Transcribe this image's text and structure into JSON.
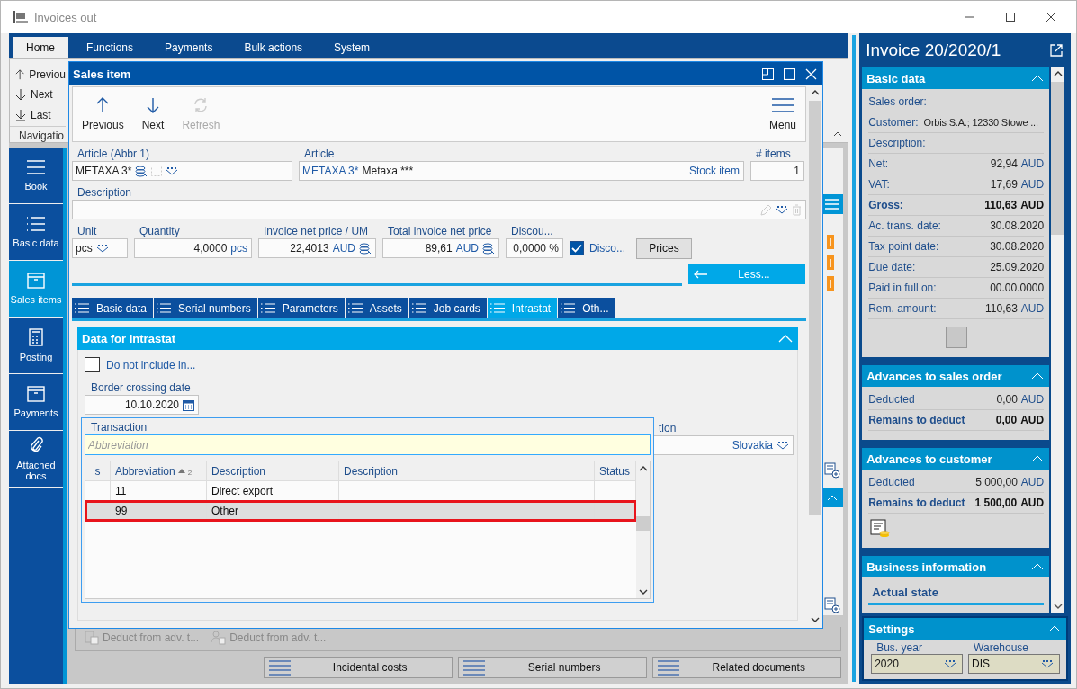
{
  "window": {
    "title": "Invoices out"
  },
  "ribbon": {
    "tabs": [
      {
        "label": "Home",
        "selected": true
      },
      {
        "label": "Functions",
        "selected": false
      },
      {
        "label": "Payments",
        "selected": false
      },
      {
        "label": "Bulk actions",
        "selected": false
      },
      {
        "label": "System",
        "selected": false
      }
    ],
    "items": [
      {
        "label": "Previou",
        "kind": "up"
      },
      {
        "label": "Next",
        "kind": "down"
      },
      {
        "label": "Last",
        "kind": "last"
      }
    ],
    "group": "Navigatio"
  },
  "nav": [
    {
      "label": "Book",
      "kind": "lines",
      "selected": false
    },
    {
      "label": "Basic data",
      "kind": "list",
      "selected": false
    },
    {
      "label": "Sales items",
      "kind": "box",
      "selected": true
    },
    {
      "label": "Posting",
      "kind": "calc",
      "selected": false
    },
    {
      "label": "Payments",
      "kind": "box",
      "selected": false
    },
    {
      "label": "Attached docs",
      "kind": "clip",
      "selected": false
    }
  ],
  "deduct_buttons": [
    {
      "label": "Deduct from adv. t...",
      "kind": "doc",
      "disabled": true
    },
    {
      "label": "Deduct from adv. t...",
      "kind": "person",
      "disabled": true
    }
  ],
  "bottom_buttons": [
    "Incidental costs",
    "Serial numbers",
    "Related documents"
  ],
  "dialog": {
    "title": "Sales item",
    "toolbar": [
      {
        "label": "Previous",
        "kind": "up",
        "disabled": false
      },
      {
        "label": "Next",
        "kind": "down",
        "disabled": false
      },
      {
        "label": "Refresh",
        "kind": "refresh",
        "disabled": true
      }
    ],
    "menu": "Menu",
    "article_abbr": {
      "label": "Article (Abbr 1)",
      "value": "METAXA 3*"
    },
    "article": {
      "label": "Article",
      "code": "METAXA 3*",
      "name": "Metaxa ***",
      "type": "Stock item"
    },
    "items_count": {
      "label": "# items",
      "value": "1"
    },
    "description": {
      "label": "Description"
    },
    "unit": {
      "label": "Unit",
      "value": "pcs"
    },
    "quantity": {
      "label": "Quantity",
      "value": "4,0000",
      "unit": "pcs"
    },
    "unit_price": {
      "label": "Invoice net price / UM",
      "value": "22,4013",
      "unit": "AUD"
    },
    "total_price": {
      "label": "Total invoice net price",
      "value": "89,61",
      "unit": "AUD"
    },
    "discount": {
      "label": "Discou...",
      "value": "0,0000 %"
    },
    "discount_check": {
      "label": "Disco...",
      "checked": true
    },
    "prices_button": "Prices",
    "less_button": "Less...",
    "tabs": [
      {
        "label": "Basic data",
        "selected": false
      },
      {
        "label": "Serial numbers",
        "selected": false
      },
      {
        "label": "Parameters",
        "selected": false
      },
      {
        "label": "Assets",
        "selected": false
      },
      {
        "label": "Job cards",
        "selected": false
      },
      {
        "label": "Intrastat",
        "selected": true
      },
      {
        "label": "Oth...",
        "selected": false
      }
    ],
    "intrastat": {
      "title": "Data for Intrastat",
      "exclude": {
        "label": "Do not include in...",
        "checked": false
      },
      "border_date": {
        "label": "Border crossing date",
        "value": "10.10.2020"
      },
      "country": {
        "label": "tion",
        "value": "Slovakia"
      }
    },
    "lookup": {
      "label": "Transaction",
      "placeholder": "Abbreviation",
      "columns": [
        {
          "label": "s"
        },
        {
          "label": "Abbreviation",
          "sort": "2"
        },
        {
          "label": "Description"
        },
        {
          "label": "Description"
        },
        {
          "label": "Status"
        }
      ],
      "rows": [
        {
          "abbr": "11",
          "description": "Direct export",
          "selected": false
        },
        {
          "abbr": "99",
          "description": "Other",
          "selected": true
        }
      ]
    }
  },
  "info_panel": {
    "title": "Invoice 20/2020/1",
    "sections": [
      {
        "title": "Basic data",
        "kind": "button",
        "rows": [
          {
            "label": "Sales order:",
            "emphasis": false
          },
          {
            "label": "Customer:",
            "value": "Orbis S.A.; 12330 Stowe ...",
            "kind": "inline",
            "emphasis": false
          },
          {
            "label": "Description:",
            "emphasis": false
          },
          {
            "label": "Net:",
            "value": "92,94",
            "unit": "AUD",
            "emphasis": false
          },
          {
            "label": "VAT:",
            "value": "17,69",
            "unit": "AUD",
            "emphasis": false
          },
          {
            "label": "Gross:",
            "value": "110,63",
            "unit": "AUD",
            "emphasis": true
          },
          {
            "label": "Ac. trans. date:",
            "value": "30.08.2020",
            "emphasis": false
          },
          {
            "label": "Tax point date:",
            "value": "30.08.2020",
            "emphasis": false
          },
          {
            "label": "Due date:",
            "value": "25.09.2020",
            "emphasis": false
          },
          {
            "label": "Paid in full on:",
            "value": "00.00.0000",
            "emphasis": false
          },
          {
            "label": "Rem. amount:",
            "value": "110,63",
            "unit": "AUD",
            "emphasis": false
          }
        ]
      },
      {
        "title": "Advances to sales order",
        "kind": "plain",
        "rows": [
          {
            "label": "Deducted",
            "value": "0,00",
            "unit": "AUD",
            "emphasis": false
          },
          {
            "label": "Remains to deduct",
            "value": "0,00",
            "unit": "AUD",
            "emphasis": true
          }
        ]
      },
      {
        "title": "Advances to customer",
        "kind": "document",
        "rows": [
          {
            "label": "Deducted",
            "value": "5 000,00",
            "unit": "AUD",
            "emphasis": false
          },
          {
            "label": "Remains to deduct",
            "value": "1 500,00",
            "unit": "AUD",
            "emphasis": true
          }
        ]
      },
      {
        "title": "Business information",
        "kind": "plain",
        "subtitle": "Actual state"
      }
    ],
    "settings": {
      "title": "Settings",
      "fields": [
        {
          "label": "Bus. year",
          "value": "2020"
        },
        {
          "label": "Warehouse",
          "value": "DIS"
        }
      ]
    }
  }
}
